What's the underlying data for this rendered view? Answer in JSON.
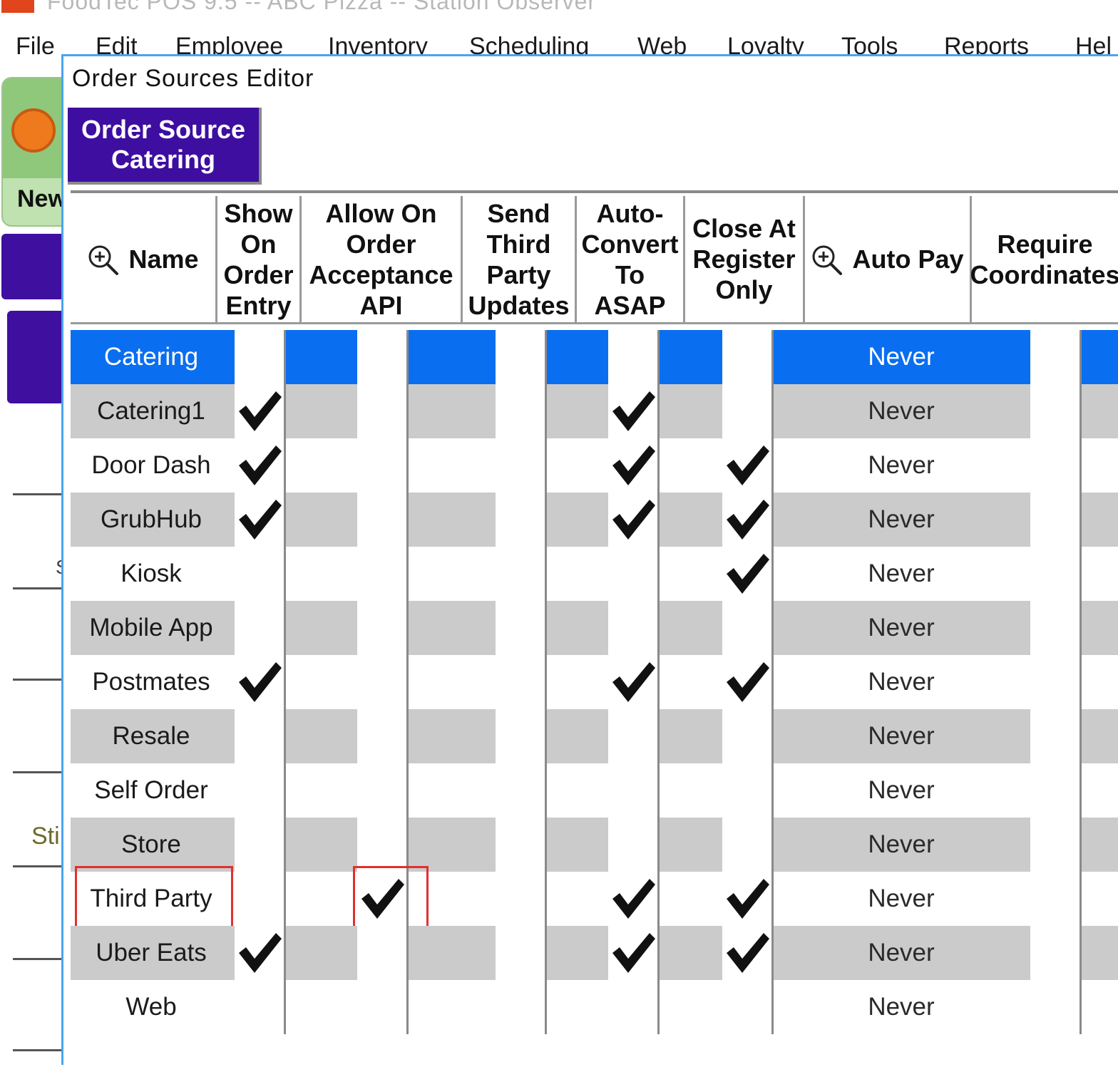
{
  "app": {
    "title": "FoodTec POS 9.5 -- ABC Pizza -- Station Observer"
  },
  "menu": {
    "items": [
      "File",
      "Edit",
      "Employee",
      "Inventory",
      "Scheduling",
      "Web",
      "Loyalty",
      "Tools",
      "Reports",
      "Hel"
    ]
  },
  "left_panel": {
    "new_label": "New",
    "partial_labels": [
      "S",
      "Sti"
    ]
  },
  "dialog": {
    "title": "Order Sources Editor",
    "order_source_button": {
      "line1": "Order Source",
      "line2": "Catering"
    }
  },
  "table": {
    "columns": [
      {
        "key": "name",
        "label_lines": [
          "Name"
        ],
        "has_zoom_icon": true
      },
      {
        "key": "show_on_order_entry",
        "label_lines": [
          "Show",
          "On",
          "Order",
          "Entry"
        ]
      },
      {
        "key": "allow_on_order_acceptance_api",
        "label_lines": [
          "Allow On",
          "Order",
          "Acceptance",
          "API"
        ]
      },
      {
        "key": "send_third_party_updates",
        "label_lines": [
          "Send",
          "Third",
          "Party",
          "Updates"
        ]
      },
      {
        "key": "auto_convert_to_asap",
        "label_lines": [
          "Auto-",
          "Convert",
          "To",
          "ASAP"
        ]
      },
      {
        "key": "close_at_register_only",
        "label_lines": [
          "Close At",
          "Register",
          "Only"
        ]
      },
      {
        "key": "auto_pay",
        "label_lines": [
          "Auto Pay"
        ],
        "has_zoom_icon": true
      },
      {
        "key": "require_coordinates",
        "label_lines": [
          "Require",
          "Coordinates"
        ]
      }
    ],
    "rows": [
      {
        "name": "Catering",
        "show": false,
        "allow_api": false,
        "send_tp": false,
        "auto_asap": false,
        "close_reg": false,
        "auto_pay": "Never",
        "selected": true
      },
      {
        "name": "Catering1",
        "show": true,
        "allow_api": false,
        "send_tp": false,
        "auto_asap": true,
        "close_reg": false,
        "auto_pay": "Never"
      },
      {
        "name": "Door Dash",
        "show": true,
        "allow_api": false,
        "send_tp": false,
        "auto_asap": true,
        "close_reg": true,
        "auto_pay": "Never"
      },
      {
        "name": "GrubHub",
        "show": true,
        "allow_api": false,
        "send_tp": false,
        "auto_asap": true,
        "close_reg": true,
        "auto_pay": "Never"
      },
      {
        "name": "Kiosk",
        "show": false,
        "allow_api": false,
        "send_tp": false,
        "auto_asap": false,
        "close_reg": true,
        "auto_pay": "Never"
      },
      {
        "name": "Mobile App",
        "show": false,
        "allow_api": false,
        "send_tp": false,
        "auto_asap": false,
        "close_reg": false,
        "auto_pay": "Never"
      },
      {
        "name": "Postmates",
        "show": true,
        "allow_api": false,
        "send_tp": false,
        "auto_asap": true,
        "close_reg": true,
        "auto_pay": "Never"
      },
      {
        "name": "Resale",
        "show": false,
        "allow_api": false,
        "send_tp": false,
        "auto_asap": false,
        "close_reg": false,
        "auto_pay": "Never"
      },
      {
        "name": "Self Order",
        "show": false,
        "allow_api": false,
        "send_tp": false,
        "auto_asap": false,
        "close_reg": false,
        "auto_pay": "Never"
      },
      {
        "name": "Store",
        "show": false,
        "allow_api": false,
        "send_tp": false,
        "auto_asap": false,
        "close_reg": false,
        "auto_pay": "Never"
      },
      {
        "name": "Third Party",
        "show": false,
        "allow_api": true,
        "send_tp": false,
        "auto_asap": true,
        "close_reg": true,
        "auto_pay": "Never",
        "highlighted": true
      },
      {
        "name": "Uber Eats",
        "show": true,
        "allow_api": false,
        "send_tp": false,
        "auto_asap": true,
        "close_reg": true,
        "auto_pay": "Never"
      },
      {
        "name": "Web",
        "show": false,
        "allow_api": false,
        "send_tp": false,
        "auto_asap": false,
        "close_reg": false,
        "auto_pay": "Never"
      }
    ]
  },
  "colors": {
    "selected_row": "#0a6ef0",
    "alt_row": "#cbcbcb",
    "purple_button": "#3e0ea0",
    "highlight_box": "#e03030",
    "dialog_border": "#4aa3f0"
  },
  "icons": {
    "zoom": "zoom-in-icon",
    "check": "check-mark-icon"
  }
}
